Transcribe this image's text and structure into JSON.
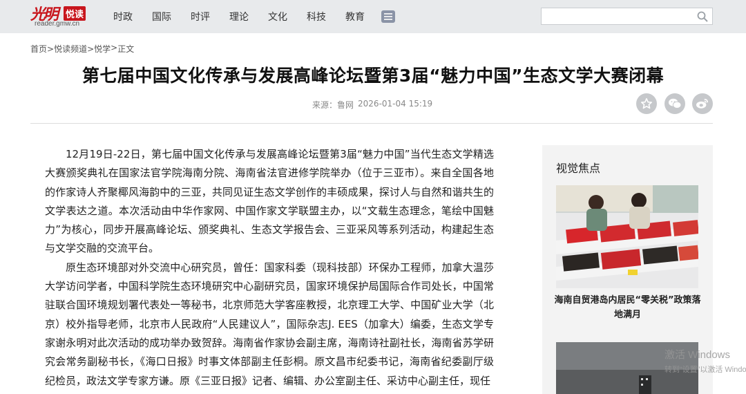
{
  "header": {
    "logo_script": "光明",
    "logo_badge": "悦读",
    "logo_url": "reader.gmw.cn",
    "nav": [
      "时政",
      "国际",
      "时评",
      "理论",
      "文化",
      "科技",
      "教育"
    ],
    "search": {
      "value": "",
      "placeholder": ""
    }
  },
  "breadcrumb": [
    "首页>",
    "悦读频道>",
    "悦学",
    ">",
    "正文"
  ],
  "article": {
    "title": "第七届中国文化传承与发展高峰论坛暨第3届“魅力中国”生态文学大赛闭幕",
    "source_label": "来源：",
    "source": "鲁网",
    "datetime": "2026-01-04 15:19",
    "paragraphs": [
      "12月19日-22日，第七届中国文化传承与发展高峰论坛暨第3届“魅力中国”当代生态文学精选大赛颁奖典礼在国家法官学院海南分院、海南省法官进修学院举办（位于三亚市）。来自全国各地的作家诗人齐聚椰风海韵中的三亚，共同见证生态文学创作的丰硕成果，探讨人与自然和谐共生的文学表达之道。本次活动由中华作家网、中国作家文学联盟主办，以“文载生态理念，笔绘中国魅力”为核心，同步开展高峰论坛、颁奖典礼、生态文学报告会、三亚采风等系列活动，构建起生态与文学交融的交流平台。",
      "原生态环境部对外交流中心研究员，曾任：国家科委（现科技部）环保办工程师，加拿大温莎大学访问学者，中国科学院生态环境研究中心副研究员，国家环境保护局国际合作司处长，中国常驻联合国环境规划署代表处一等秘书，北京师范大学客座教授，北京理工大学、中国矿业大学（北京）校外指导老师，北京市人民政府“人民建议人”，国际杂志J. EES（加拿大）编委，生态文学专家谢永明对此次活动的成功举办致贺辞。海南省作家协会副主席，海南诗社副社长，海南省苏学研究会常务副秘书长，《海口日报》时事文体部副主任彭桐。原文昌市纪委书记，海南省纪委副厅级纪检员，政法文学专家方谦。原《三亚日报》记者、编辑、办公室副主任、采访中心副主任，现任"
    ]
  },
  "sidebar": {
    "title": "视觉焦点",
    "caption": "海南自贸港岛内居民“零关税”政策落地满月"
  },
  "watermark": {
    "line1": "激活 Windows",
    "line2": "转到“设置”以激活 Windows。"
  },
  "colors": {
    "brand_red": "#c8161d",
    "nav_bg": "#e8eaec",
    "share_gray": "#c6c8cb"
  }
}
